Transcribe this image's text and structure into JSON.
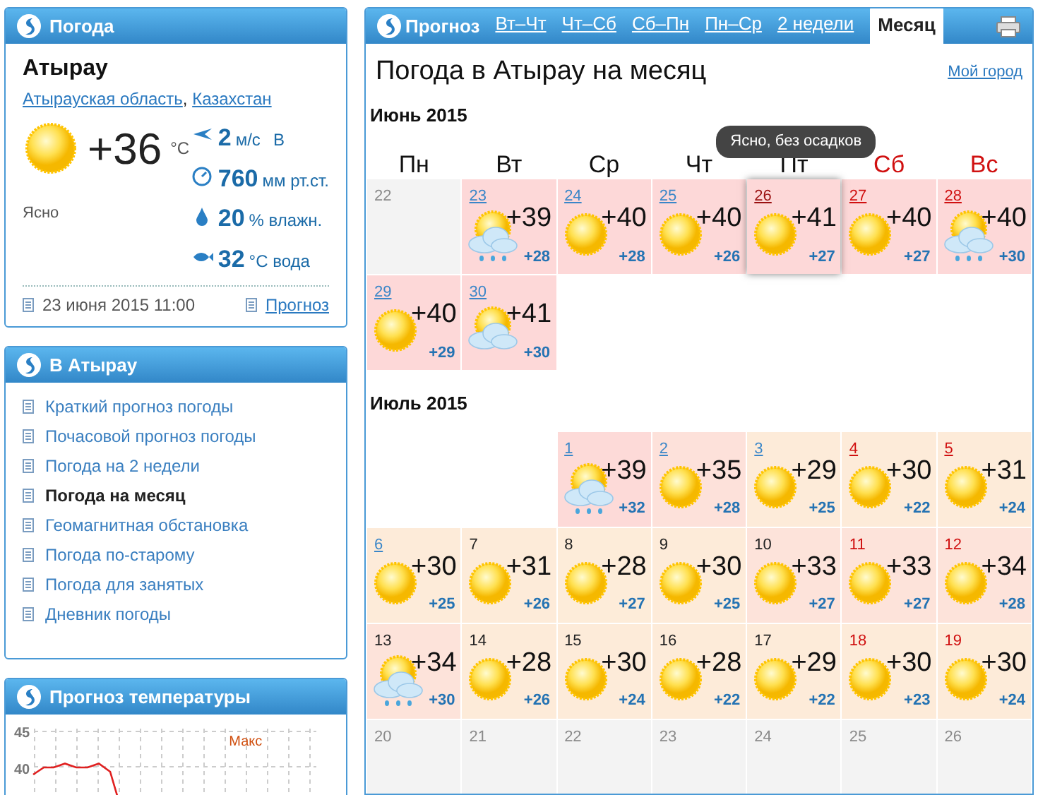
{
  "now_panel": {
    "title": "Погода",
    "city": "Атырау",
    "region_links": [
      "Атырауская область",
      "Казахстан"
    ],
    "region_separator": ",",
    "temperature": "+36",
    "unit": "°C",
    "condition": "Ясно",
    "stats": [
      {
        "kind": "wind",
        "value": "2",
        "unit": "м/с",
        "extra": "В"
      },
      {
        "kind": "pressure",
        "value": "760",
        "unit": "мм рт.ст."
      },
      {
        "kind": "humidity",
        "value": "20",
        "unit": "% влажн."
      },
      {
        "kind": "water",
        "value": "32",
        "unit": "°C вода"
      }
    ],
    "updated": "23 июня 2015 11:00",
    "forecast_link": "Прогноз"
  },
  "city_panel": {
    "title": "В Атырау",
    "items": [
      {
        "label": "Краткий прогноз погоды",
        "selected": false
      },
      {
        "label": "Почасовой прогноз погоды",
        "selected": false
      },
      {
        "label": "Погода на 2 недели",
        "selected": false
      },
      {
        "label": "Погода на месяц",
        "selected": true
      },
      {
        "label": "Геомагнитная обстановка",
        "selected": false
      },
      {
        "label": "Погода по-старому",
        "selected": false
      },
      {
        "label": "Погода для занятых",
        "selected": false
      },
      {
        "label": "Дневник погоды",
        "selected": false
      }
    ]
  },
  "chart_panel": {
    "title": "Прогноз температуры",
    "yticks": [
      "45",
      "40"
    ],
    "legend": "Макс"
  },
  "forecast": {
    "title": "Прогноз",
    "tabs": [
      {
        "label": "Вт–Чт",
        "selected": false
      },
      {
        "label": "Чт–Сб",
        "selected": false
      },
      {
        "label": "Сб–Пн",
        "selected": false
      },
      {
        "label": "Пн–Ср",
        "selected": false
      },
      {
        "label": "2 недели",
        "selected": false
      },
      {
        "label": "Месяц",
        "selected": true
      }
    ],
    "heading": "Погода в Атырау на месяц",
    "my_city": "Мой город",
    "weekdays": [
      {
        "label": "Пн",
        "weekend": false
      },
      {
        "label": "Вт",
        "weekend": false
      },
      {
        "label": "Ср",
        "weekend": false
      },
      {
        "label": "Чт",
        "weekend": false
      },
      {
        "label": "Пт",
        "weekend": false
      },
      {
        "label": "Сб",
        "weekend": true
      },
      {
        "label": "Вс",
        "weekend": true
      }
    ],
    "tooltip": "Ясно, без осадков",
    "months": [
      {
        "title": "Июнь 2015",
        "weeks": [
          {
            "from_end": false,
            "cells": [
              {
                "date": "22",
                "disabled": true
              },
              {
                "date": "23",
                "link": true,
                "weekend": false,
                "hovered": false,
                "kind": "rain",
                "max": "+39",
                "min": "+28",
                "color": "#fdd8d8"
              },
              {
                "date": "24",
                "link": true,
                "weekend": false,
                "hovered": false,
                "kind": "sun",
                "max": "+40",
                "min": "+28",
                "color": "#fdd8d8"
              },
              {
                "date": "25",
                "link": true,
                "weekend": false,
                "hovered": false,
                "kind": "sun",
                "max": "+40",
                "min": "+26",
                "color": "#fdd8d8"
              },
              {
                "date": "26",
                "link": true,
                "weekend": false,
                "hovered": true,
                "kind": "sun",
                "max": "+41",
                "min": "+27",
                "color": "#fdd8d8"
              },
              {
                "date": "27",
                "link": true,
                "weekend": true,
                "hovered": false,
                "kind": "sun",
                "max": "+40",
                "min": "+27",
                "color": "#fdd8d8"
              },
              {
                "date": "28",
                "link": true,
                "weekend": true,
                "hovered": false,
                "kind": "rain",
                "max": "+40",
                "min": "+30",
                "color": "#fdd8d8"
              }
            ]
          },
          {
            "from_end": false,
            "cells": [
              {
                "date": "29",
                "link": true,
                "weekend": false,
                "hovered": false,
                "kind": "sun",
                "max": "+40",
                "min": "+29",
                "color": "#fdd8d8"
              },
              {
                "date": "30",
                "link": true,
                "weekend": false,
                "hovered": false,
                "kind": "cloud",
                "max": "+41",
                "min": "+30",
                "color": "#fdd8d8"
              }
            ]
          }
        ]
      },
      {
        "title": "Июль 2015",
        "weeks": [
          {
            "from_end": true,
            "cells": [
              {
                "date": "1",
                "link": true,
                "weekend": false,
                "hovered": false,
                "kind": "rain",
                "max": "+39",
                "min": "+32",
                "color": "#fddad8"
              },
              {
                "date": "2",
                "link": true,
                "weekend": false,
                "hovered": false,
                "kind": "sun",
                "max": "+35",
                "min": "+28",
                "color": "#fde1da"
              },
              {
                "date": "3",
                "link": true,
                "weekend": false,
                "hovered": false,
                "kind": "sun",
                "max": "+29",
                "min": "+25",
                "color": "#fdebd9"
              },
              {
                "date": "4",
                "link": true,
                "weekend": true,
                "hovered": false,
                "kind": "sun",
                "max": "+30",
                "min": "+22",
                "color": "#fdebd9"
              },
              {
                "date": "5",
                "link": true,
                "weekend": true,
                "hovered": false,
                "kind": "sun",
                "max": "+31",
                "min": "+24",
                "color": "#fdebd9"
              }
            ]
          },
          {
            "from_end": false,
            "cells": [
              {
                "date": "6",
                "link": true,
                "weekend": false,
                "hovered": false,
                "kind": "sun",
                "max": "+30",
                "min": "+25",
                "color": "#fdebd9"
              },
              {
                "date": "7",
                "link": false,
                "weekend": false,
                "hovered": false,
                "kind": "sun",
                "max": "+31",
                "min": "+26",
                "color": "#fdebd9"
              },
              {
                "date": "8",
                "link": false,
                "weekend": false,
                "hovered": false,
                "kind": "sun",
                "max": "+28",
                "min": "+27",
                "color": "#fdecd9"
              },
              {
                "date": "9",
                "link": false,
                "weekend": false,
                "hovered": false,
                "kind": "sun",
                "max": "+30",
                "min": "+25",
                "color": "#fdebd9"
              },
              {
                "date": "10",
                "link": false,
                "weekend": false,
                "hovered": false,
                "kind": "sun",
                "max": "+33",
                "min": "+27",
                "color": "#fde3da"
              },
              {
                "date": "11",
                "link": false,
                "weekend": true,
                "hovered": false,
                "kind": "sun",
                "max": "+33",
                "min": "+27",
                "color": "#fde3da"
              },
              {
                "date": "12",
                "link": false,
                "weekend": true,
                "hovered": false,
                "kind": "sun",
                "max": "+34",
                "min": "+28",
                "color": "#fde3da"
              }
            ]
          },
          {
            "from_end": false,
            "cells": [
              {
                "date": "13",
                "link": false,
                "weekend": false,
                "hovered": false,
                "kind": "rain",
                "max": "+34",
                "min": "+30",
                "color": "#fde3da"
              },
              {
                "date": "14",
                "link": false,
                "weekend": false,
                "hovered": false,
                "kind": "sun",
                "max": "+28",
                "min": "+26",
                "color": "#fdebd9"
              },
              {
                "date": "15",
                "link": false,
                "weekend": false,
                "hovered": false,
                "kind": "sun",
                "max": "+30",
                "min": "+24",
                "color": "#fdebd9"
              },
              {
                "date": "16",
                "link": false,
                "weekend": false,
                "hovered": false,
                "kind": "sun",
                "max": "+28",
                "min": "+22",
                "color": "#fdebd9"
              },
              {
                "date": "17",
                "link": false,
                "weekend": false,
                "hovered": false,
                "kind": "sun",
                "max": "+29",
                "min": "+22",
                "color": "#fdebd9"
              },
              {
                "date": "18",
                "link": false,
                "weekend": true,
                "hovered": false,
                "kind": "sun",
                "max": "+30",
                "min": "+23",
                "color": "#fdebd9"
              },
              {
                "date": "19",
                "link": false,
                "weekend": true,
                "hovered": false,
                "kind": "sun",
                "max": "+30",
                "min": "+24",
                "color": "#fdebd9"
              }
            ]
          },
          {
            "from_end": false,
            "cells": [
              {
                "date": "20",
                "disabled": true
              },
              {
                "date": "21",
                "disabled": true
              },
              {
                "date": "22",
                "disabled": true
              },
              {
                "date": "23",
                "disabled": true
              },
              {
                "date": "24",
                "disabled": true
              },
              {
                "date": "25",
                "disabled": true
              },
              {
                "date": "26",
                "disabled": true
              }
            ]
          }
        ]
      }
    ]
  }
}
